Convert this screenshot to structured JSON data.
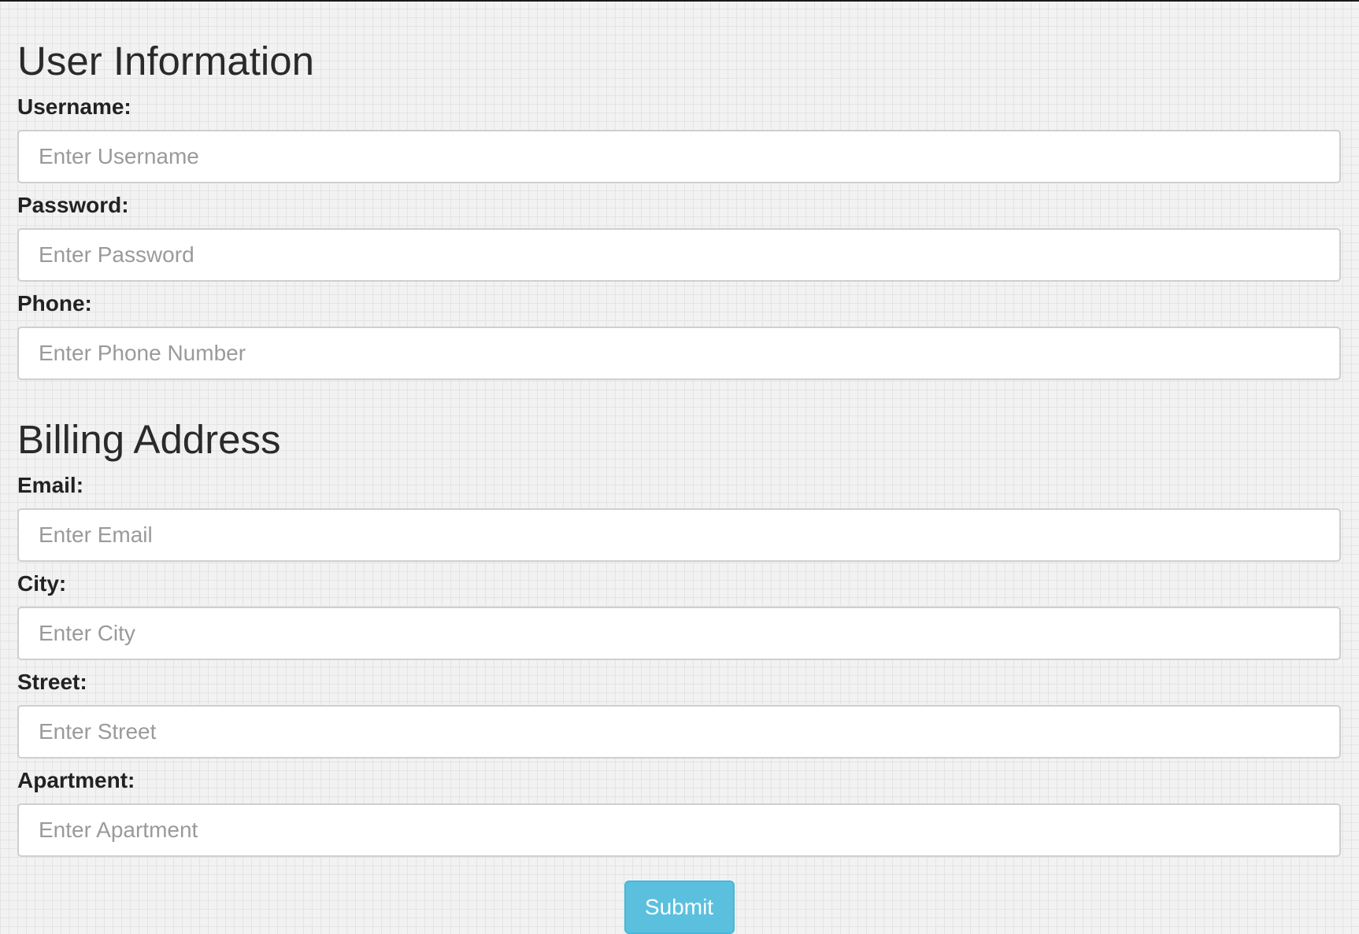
{
  "user_information": {
    "heading": "User Information",
    "fields": [
      {
        "label": "Username:",
        "placeholder": "Enter Username",
        "value": ""
      },
      {
        "label": "Password:",
        "placeholder": "Enter Password",
        "value": ""
      },
      {
        "label": "Phone:",
        "placeholder": "Enter Phone Number",
        "value": ""
      }
    ]
  },
  "billing_address": {
    "heading": "Billing Address",
    "fields": [
      {
        "label": "Email:",
        "placeholder": "Enter Email",
        "value": ""
      },
      {
        "label": "City:",
        "placeholder": "Enter City",
        "value": ""
      },
      {
        "label": "Street:",
        "placeholder": "Enter Street",
        "value": ""
      },
      {
        "label": "Apartment:",
        "placeholder": "Enter Apartment",
        "value": ""
      }
    ]
  },
  "submit": {
    "label": "Submit"
  },
  "colors": {
    "button_background": "#5bc0de",
    "button_border": "#46b8da",
    "input_border": "#cfcfcf",
    "page_background": "#f2f2f2"
  }
}
